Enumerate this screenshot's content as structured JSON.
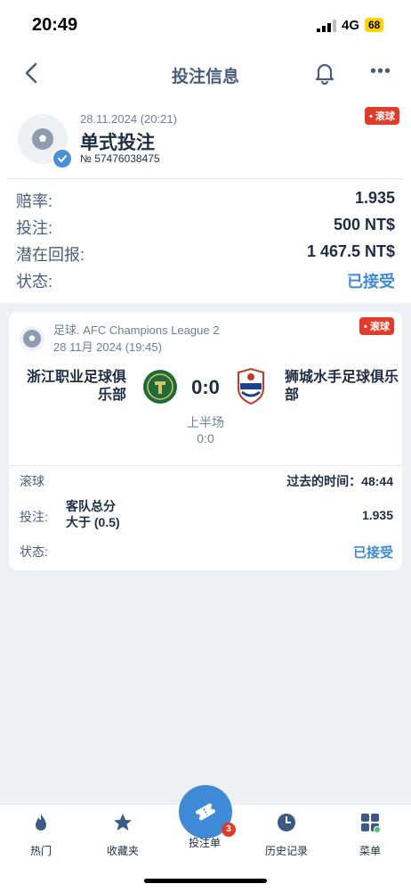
{
  "status_bar": {
    "time": "20:49",
    "network": "4G",
    "battery": "68"
  },
  "nav": {
    "title": "投注信息"
  },
  "bet": {
    "date": "28.11.2024 (20:21)",
    "type": "单式投注",
    "number": "№ 57476038475",
    "live_badge": "• 滚球",
    "rows": [
      {
        "label": "赔率:",
        "value": "1.935"
      },
      {
        "label": "投注:",
        "value": "500 NT$"
      },
      {
        "label": "潜在回报:",
        "value": "1 467.5 NT$"
      },
      {
        "label": "状态:",
        "value": "已接受"
      }
    ]
  },
  "match": {
    "live_badge": "• 滚球",
    "league": "足球. AFC Champions League 2",
    "date": "28 11月 2024 (19:45)",
    "home": "浙江职业足球俱乐部",
    "away": "狮城水手足球俱乐部",
    "score": "0:0",
    "period": "上半场",
    "period_score": "0:0",
    "live_label": "滚球",
    "elapsed": "过去的时间：48:44",
    "bet_label": "投注:",
    "market_line1": "客队总分",
    "market_line2": "大于 (0.5)",
    "odds": "1.935",
    "status_label": "状态:",
    "status_value": "已接受"
  },
  "tabbar": {
    "items": [
      {
        "label": "热门",
        "icon": "fire-icon"
      },
      {
        "label": "收藏夹",
        "icon": "star-icon"
      },
      {
        "label": "投注单",
        "icon": "ticket-icon",
        "badge": "3"
      },
      {
        "label": "历史记录",
        "icon": "clock-icon"
      },
      {
        "label": "菜单",
        "icon": "grid-icon"
      }
    ]
  },
  "colors": {
    "accent": "#3f8ad6",
    "live": "#e23b2a",
    "text": "#1f2d44",
    "muted": "#4a5d7a"
  }
}
